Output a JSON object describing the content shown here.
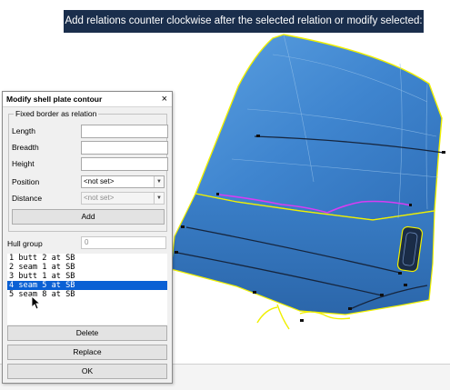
{
  "viewport": {
    "prompt": "Add relations counter clockwise after the selected relation or modify selected:",
    "colors": {
      "plate": "#3f85cf",
      "plate_dark": "#24548f",
      "border": "#f0f000",
      "highlight": "#d83cf4",
      "background": "#ffffff"
    }
  },
  "dialog": {
    "title": "Modify shell plate contour",
    "close_glyph": "×",
    "group_title": "Fixed border as relation",
    "labels": {
      "length": "Length",
      "breadth": "Breadth",
      "height": "Height",
      "position": "Position",
      "distance": "Distance",
      "hull_group": "Hull group"
    },
    "values": {
      "length": "",
      "breadth": "",
      "height": "",
      "position": "<not set>",
      "distance": "<not set>",
      "hull_group": "0"
    },
    "buttons": {
      "add": "Add",
      "delete": "Delete",
      "replace": "Replace",
      "ok": "OK"
    },
    "relations": [
      "1 butt 2 at SB",
      "2 seam 1 at SB",
      "3 butt 1 at SB",
      "4 seam 5 at SB",
      "5 seam 8 at SB"
    ],
    "selected_relation_index": 3
  }
}
